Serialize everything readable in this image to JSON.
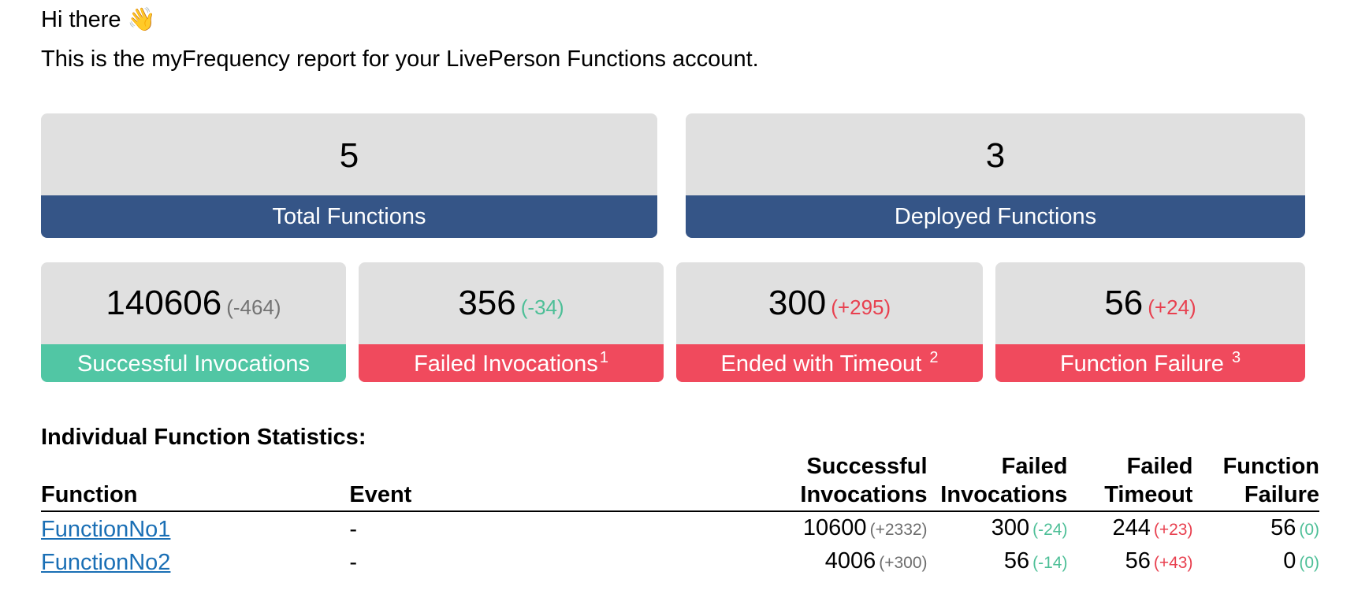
{
  "greeting": "Hi there 👋",
  "intro": "This is the myFrequency report for your LivePerson Functions account.",
  "summary": {
    "total": {
      "value": "5",
      "label": "Total Functions"
    },
    "deployed": {
      "value": "3",
      "label": "Deployed Functions"
    }
  },
  "metrics": {
    "successful": {
      "value": "140606",
      "delta": "(-464)",
      "label": "Successful Invocations"
    },
    "failed": {
      "value": "356",
      "delta": "(-34)",
      "label": "Failed Invocations",
      "footnote": "1"
    },
    "timeout": {
      "value": "300",
      "delta": "(+295)",
      "label": "Ended with Timeout ",
      "footnote": "2"
    },
    "failure": {
      "value": "56",
      "delta": "(+24)",
      "label": "Function Failure ",
      "footnote": "3"
    }
  },
  "colors": {
    "band_blue": "#355587",
    "band_green": "#51c6a4",
    "band_red": "#f04a5d",
    "card_bg": "#e0e0e0",
    "link": "#1a6fb5"
  },
  "table": {
    "title": "Individual Function Statistics:",
    "headers": {
      "function": "Function",
      "event": "Event",
      "successful_1": "Successful",
      "successful_2": "Invocations",
      "failed_1": "Failed",
      "failed_2": "Invocations",
      "timeout_1": "Failed",
      "timeout_2": "Timeout",
      "failure_1": "Function",
      "failure_2": "Failure"
    },
    "rows": [
      {
        "function": "FunctionNo1",
        "event": "-",
        "successful": "10600",
        "successful_delta": "(+2332)",
        "failed": "300",
        "failed_delta": "(-24)",
        "timeout": "244",
        "timeout_delta": "(+23)",
        "failure": "56",
        "failure_delta": "(0)"
      },
      {
        "function": "FunctionNo2",
        "event": "-",
        "successful": "4006",
        "successful_delta": "(+300)",
        "failed": "56",
        "failed_delta": "(-14)",
        "timeout": "56",
        "timeout_delta": "(+43)",
        "failure": "0",
        "failure_delta": "(0)"
      }
    ]
  }
}
